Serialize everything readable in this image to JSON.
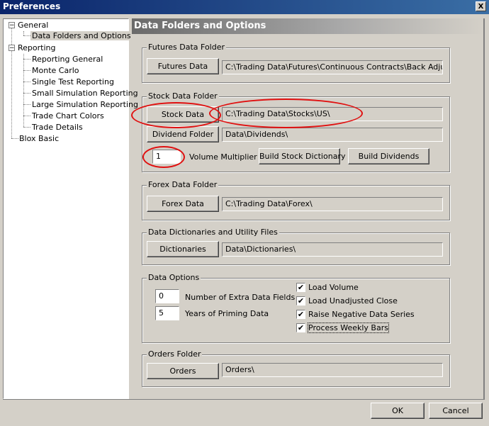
{
  "window": {
    "title": "Preferences",
    "close_glyph": "X"
  },
  "tree": {
    "items": [
      {
        "label": "General",
        "expander": "−"
      },
      {
        "label": "Data Folders and Options"
      },
      {
        "label": "Reporting",
        "expander": "−"
      },
      {
        "label": "Reporting General"
      },
      {
        "label": "Monte Carlo"
      },
      {
        "label": "Single Test Reporting"
      },
      {
        "label": "Small Simulation Reporting"
      },
      {
        "label": "Large Simulation Reporting"
      },
      {
        "label": "Trade Chart Colors"
      },
      {
        "label": "Trade Details"
      },
      {
        "label": "Blox Basic"
      }
    ]
  },
  "panel": {
    "header": "Data Folders and Options"
  },
  "futures": {
    "group_label": "Futures Data Folder",
    "button": "Futures Data",
    "path": "C:\\Trading Data\\Futures\\Continuous Contracts\\Back Adjusted\\"
  },
  "stock": {
    "group_label": "Stock Data Folder",
    "button": "Stock Data",
    "path": "C:\\Trading Data\\Stocks\\US\\",
    "dividend_button": "Dividend Folder",
    "dividend_path": "Data\\Dividends\\",
    "volume_multiplier_value": "1",
    "volume_multiplier_label": "Volume Multiplier",
    "build_dictionary_button": "Build Stock Dictionary",
    "build_dividends_button": "Build Dividends"
  },
  "forex": {
    "group_label": "Forex Data Folder",
    "button": "Forex Data",
    "path": "C:\\Trading Data\\Forex\\"
  },
  "dictionaries": {
    "group_label": "Data Dictionaries and Utility Files",
    "button": "Dictionaries",
    "path": "Data\\Dictionaries\\"
  },
  "data_options": {
    "group_label": "Data Options",
    "extra_fields_value": "0",
    "extra_fields_label": "Number of Extra Data Fields",
    "priming_value": "5",
    "priming_label": "Years of Priming Data",
    "checkboxes": [
      {
        "label": "Load Volume",
        "checked": true
      },
      {
        "label": "Load Unadjusted Close",
        "checked": true
      },
      {
        "label": "Raise Negative Data Series",
        "checked": true
      },
      {
        "label": "Process Weekly Bars",
        "checked": true
      }
    ],
    "check_glyph": "✔"
  },
  "orders": {
    "group_label": "Orders Folder",
    "button": "Orders",
    "path": "Orders\\"
  },
  "footer": {
    "ok": "OK",
    "cancel": "Cancel"
  },
  "colors": {
    "annotation_oval": "#e01010",
    "title_bar": "#0a246a",
    "dialog_face": "#d4d0c8"
  }
}
